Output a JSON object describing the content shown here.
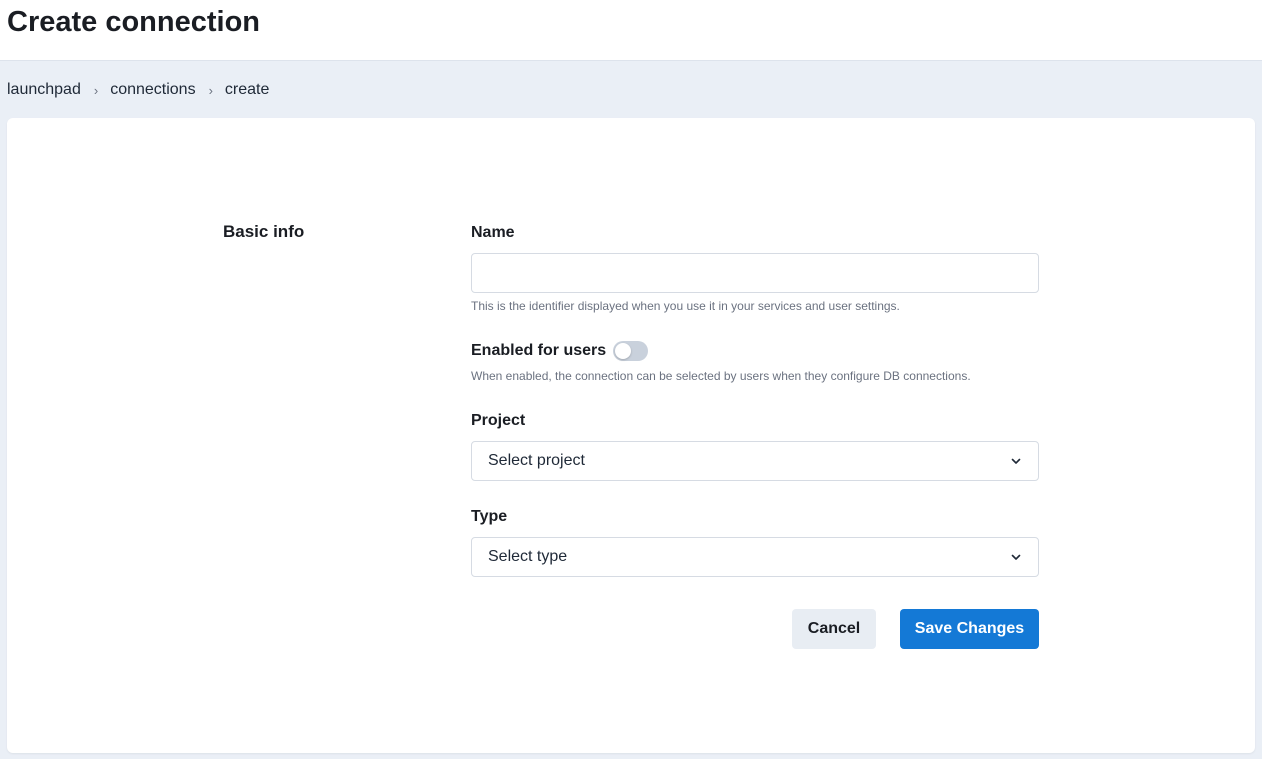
{
  "header": {
    "title": "Create connection"
  },
  "breadcrumb": {
    "items": [
      "launchpad",
      "connections",
      "create"
    ],
    "separator": "›"
  },
  "form": {
    "section_title": "Basic info",
    "name": {
      "label": "Name",
      "value": "",
      "placeholder": "",
      "help": "This is the identifier displayed when you use it in your services and user settings."
    },
    "enabled": {
      "label": "Enabled for users",
      "value": false,
      "help": "When enabled, the connection can be selected by users when they configure DB connections."
    },
    "project": {
      "label": "Project",
      "selected": "Select project"
    },
    "type": {
      "label": "Type",
      "selected": "Select type"
    }
  },
  "actions": {
    "cancel_label": "Cancel",
    "save_label": "Save Changes"
  },
  "colors": {
    "accent": "#1479d6",
    "page_bg": "#eaeff6",
    "toggle_off": "#c9d1dc"
  },
  "icons": {
    "select_chevron": "chevron-down-icon",
    "breadcrumb_separator": "chevron-right-icon"
  }
}
